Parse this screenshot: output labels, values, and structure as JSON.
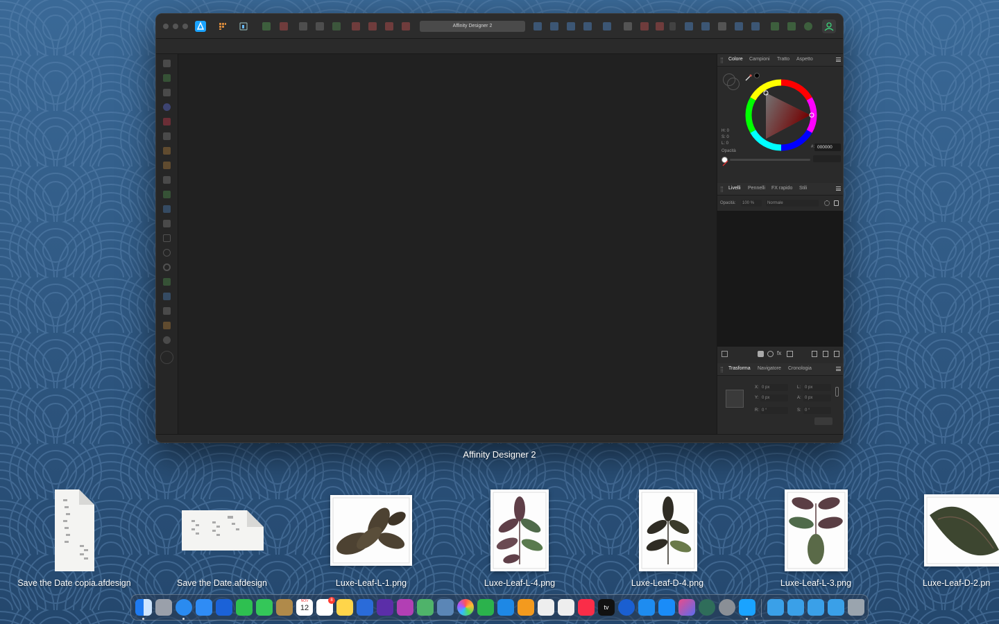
{
  "app": {
    "window_label": "Affinity Designer 2",
    "document_title": "Affinity Designer 2"
  },
  "color_panel": {
    "tabs": [
      "Colore",
      "Campioni",
      "Tratto",
      "Aspetto"
    ],
    "hsl": [
      "H: 0",
      "S: 0",
      "L: 0"
    ],
    "opacity_label": "Opacità",
    "hex_prefix": "#:",
    "hex_value": "000000"
  },
  "layers_panel": {
    "tabs": [
      "Livelli",
      "Pennelli",
      "FX rapido",
      "Stili"
    ],
    "opacity_label": "Opacità:",
    "opacity_value": "100 %",
    "blend_mode": "Normale"
  },
  "transform_panel": {
    "tabs": [
      "Trasforma",
      "Navigatore",
      "Cronologia"
    ],
    "x": "0 px",
    "y": "0 px",
    "w": "0 px",
    "h": "0 px",
    "r": "0 °",
    "s": "0 °",
    "labels": {
      "x": "X:",
      "y": "Y:",
      "w": "L:",
      "h": "A:",
      "r": "R:",
      "s": "S:"
    }
  },
  "desktop_files": [
    {
      "name": "Save the Date copia.afdesign",
      "kind": "document-portrait"
    },
    {
      "name": "Save the Date.afdesign",
      "kind": "document-landscape"
    },
    {
      "name": "Luxe-Leaf-L-1.png",
      "kind": "leaf-image"
    },
    {
      "name": "Luxe-Leaf-L-4.png",
      "kind": "leaf-image"
    },
    {
      "name": "Luxe-Leaf-D-4.png",
      "kind": "leaf-image"
    },
    {
      "name": "Luxe-Leaf-L-3.png",
      "kind": "leaf-image"
    },
    {
      "name": "Luxe-Leaf-D-2.pn",
      "kind": "leaf-image"
    }
  ],
  "dock": {
    "calendar_month": "NOV",
    "calendar_day": "12",
    "reminders_badge": "8",
    "tv_label": "tv",
    "apps": [
      "finder-icon",
      "launchpad-icon",
      "safari-icon",
      "mail-icon",
      "testflight-icon",
      "facetime-icon",
      "messages-icon",
      "contacts-icon",
      "calendar-icon",
      "reminders-icon",
      "notes-icon",
      "things-icon",
      "obsidian-icon",
      "affinity-photo-icon",
      "maps-icon",
      "preview-icon",
      "photos-icon",
      "numbers-icon",
      "keynote-icon",
      "pages-icon",
      "textedit-icon",
      "scrivener-icon",
      "music-icon",
      "tv-icon",
      "1password-icon",
      "xcode-icon",
      "app-store-icon",
      "affinity-publisher-icon",
      "time-machine-icon",
      "system-settings-icon",
      "affinity-designer-icon",
      "downloads-folder-icon",
      "documents-folder-icon",
      "applications-folder-icon",
      "desktop-folder-icon",
      "trash-icon"
    ]
  },
  "colors": {
    "desktop": "#2f5a86",
    "accent": "#1aa3ff",
    "window": "#1f1f1f"
  }
}
